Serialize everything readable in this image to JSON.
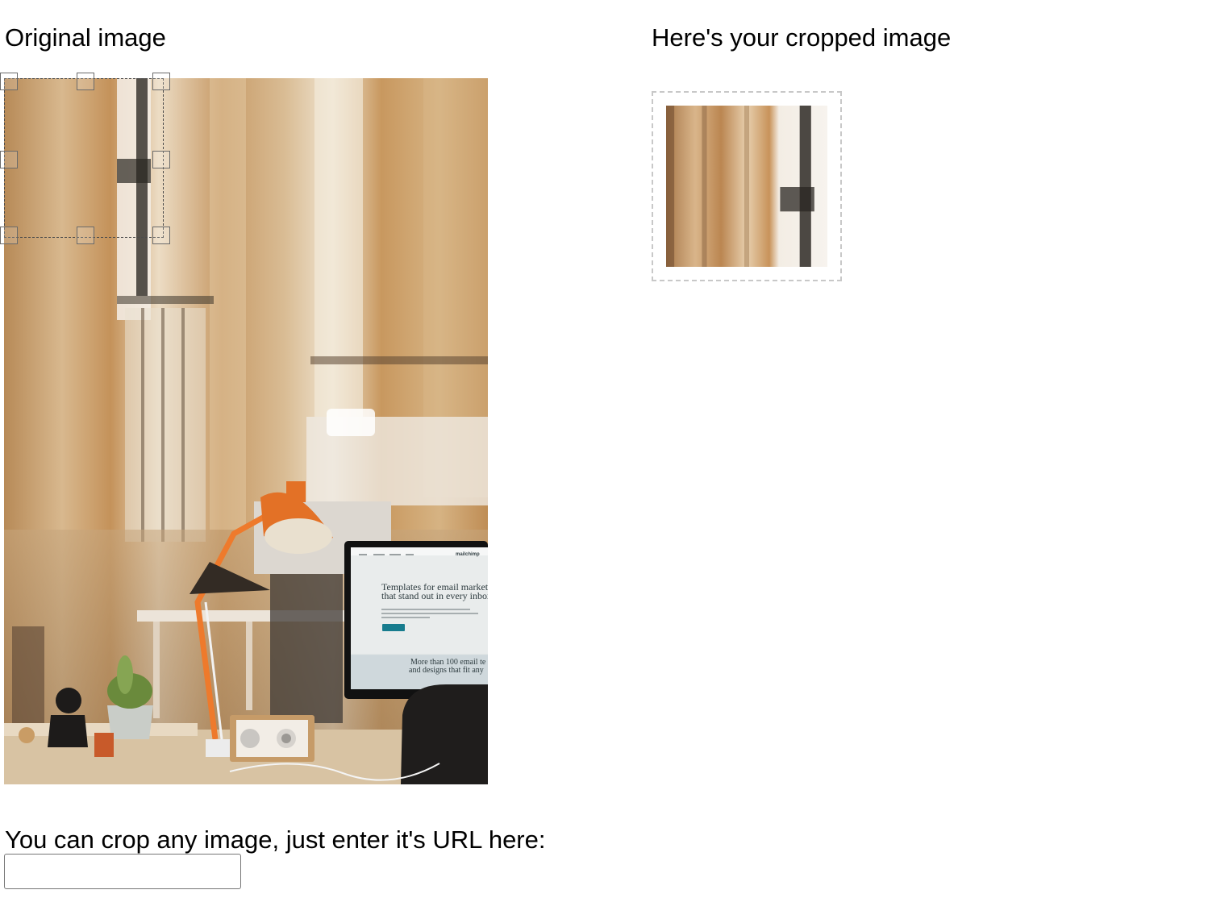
{
  "original": {
    "heading": "Original image"
  },
  "cropped": {
    "heading": "Here's your cropped image"
  },
  "photo_screen": {
    "headline_line1": "Templates for email marketing",
    "headline_line2": "that stand out in every inbox",
    "subline_line1": "More than 100 email te",
    "subline_line2": "and designs that fit any",
    "brand": "mailchimp"
  },
  "url_form": {
    "prompt": "You can crop any image, just enter it's URL here:",
    "value": ""
  }
}
